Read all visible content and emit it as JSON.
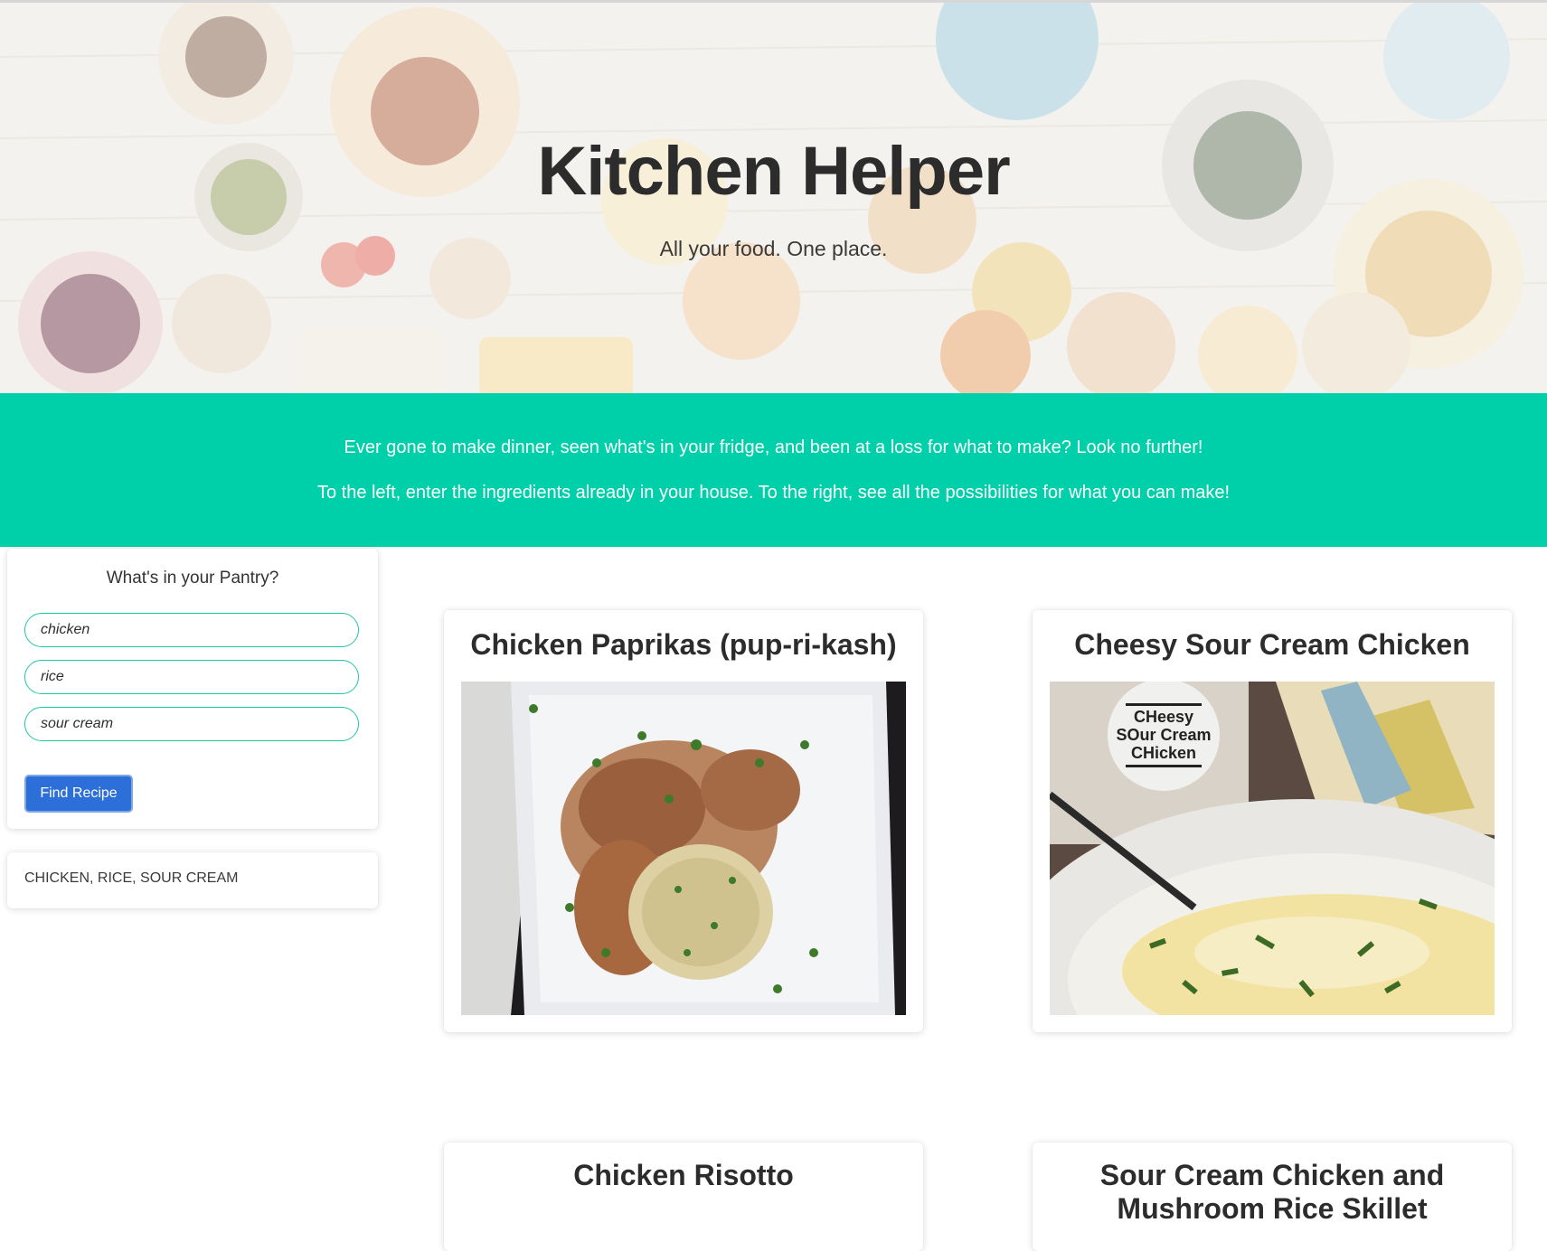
{
  "hero": {
    "title": "Kitchen Helper",
    "subtitle": "All your food. One place."
  },
  "intro": {
    "line1": "Ever gone to make dinner, seen what's in your fridge, and been at a loss for what to make? Look no further!",
    "line2": "To the left, enter the ingredients already in your house. To the right, see all the possibilities for what you can make!",
    "background_color": "#00d0aa"
  },
  "pantry": {
    "title": "What's in your Pantry?",
    "ingredients": [
      "chicken",
      "rice",
      "sour cream"
    ],
    "find_button_label": "Find Recipe",
    "selected_summary": "CHICKEN, RICE, SOUR CREAM"
  },
  "recipes": [
    {
      "title": "Chicken Paprikas (pup-ri-kash)",
      "image": "chicken-paprikas-photo"
    },
    {
      "title": "Cheesy Sour Cream Chicken",
      "image": "cheesy-sour-cream-chicken-photo",
      "image_overlay_text": "CHEESY SOUR CREAM CHICKEN"
    },
    {
      "title": "Chicken Risotto"
    },
    {
      "title": "Sour Cream Chicken and Mushroom Rice Skillet"
    }
  ],
  "colors": {
    "accent_input_border": "#1fc7a6",
    "button_blue": "#2c6fd8"
  }
}
